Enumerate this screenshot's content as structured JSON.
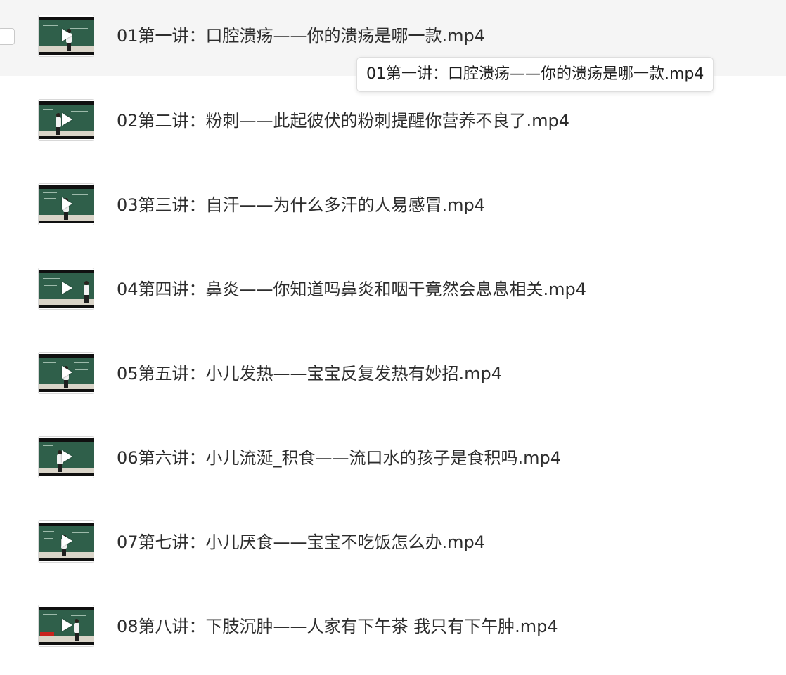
{
  "files": [
    {
      "name": "01第一讲：口腔溃疡——你的溃疡是哪一款.mp4",
      "hovered": true
    },
    {
      "name": "02第二讲：粉刺——此起彼伏的粉刺提醒你营养不良了.mp4"
    },
    {
      "name": "03第三讲：自汗——为什么多汗的人易感冒.mp4"
    },
    {
      "name": "04第四讲：鼻炎——你知道吗鼻炎和咽干竟然会息息相关.mp4"
    },
    {
      "name": "05第五讲：小儿发热——宝宝反复发热有妙招.mp4"
    },
    {
      "name": "06第六讲：小儿流涎_积食——流口水的孩子是食积吗.mp4"
    },
    {
      "name": "07第七讲：小儿厌食——宝宝不吃饭怎么办.mp4"
    },
    {
      "name": "08第八讲：下肢沉肿——人家有下午茶 我只有下午肿.mp4"
    }
  ],
  "tooltip": {
    "text": "01第一讲：口腔溃疡——你的溃疡是哪一款.mp4"
  },
  "icons": {
    "play": "play-icon",
    "thumbnail": "video-thumbnail"
  },
  "colors": {
    "hover_background": "#f5f5f5",
    "text": "#2d2d2d",
    "board": "#2f5f4a"
  }
}
